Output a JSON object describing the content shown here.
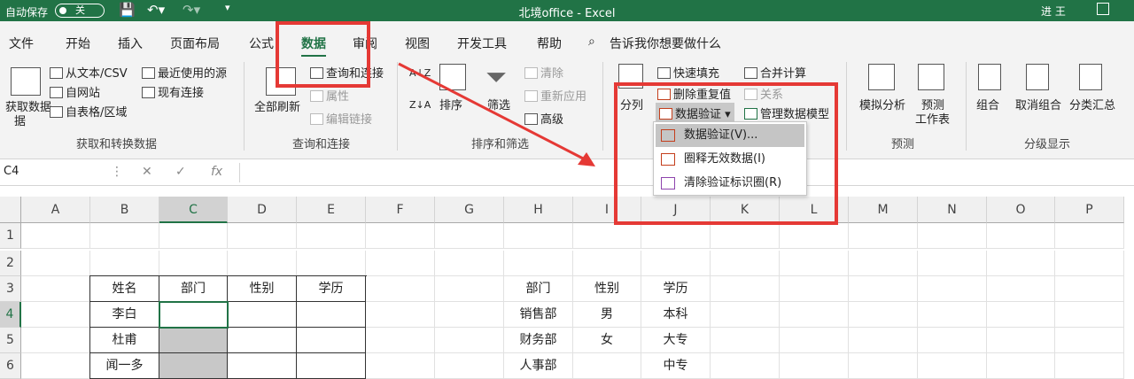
{
  "title_bar": {
    "autosave_label": "自动保存",
    "autosave_state": "关",
    "document_title": "北境office  -  Excel",
    "user_name": "进 王"
  },
  "tabs": [
    {
      "label": "文件"
    },
    {
      "label": "开始"
    },
    {
      "label": "插入"
    },
    {
      "label": "页面布局"
    },
    {
      "label": "公式"
    },
    {
      "label": "数据"
    },
    {
      "label": "审阅"
    },
    {
      "label": "视图"
    },
    {
      "label": "开发工具"
    },
    {
      "label": "帮助"
    }
  ],
  "tell_me": "告诉我你想要做什么",
  "ribbon": {
    "get_data": "获取数据",
    "get_data_2": "据",
    "from_text": "从文本/CSV",
    "from_web": "自网站",
    "from_table": "自表格/区域",
    "recent_sources": "最近使用的源",
    "existing_conn": "现有连接",
    "group_get": "获取和转换数据",
    "refresh_all": "全部刷新",
    "queries": "查询和连接",
    "properties": "属性",
    "edit_links": "编辑链接",
    "group_queries": "查询和连接",
    "sort_az": "A↓Z",
    "sort": "排序",
    "filter": "筛选",
    "clear": "清除",
    "reapply": "重新应用",
    "advanced": "高级",
    "group_sort": "排序和筛选",
    "split": "分列",
    "flash_fill": "快速填充",
    "remove_dup": "删除重复值",
    "data_validation": "数据验证",
    "consolidate": "合并计算",
    "relations": "关系",
    "manage_model": "管理数据模型",
    "what_if": "模拟分析",
    "forecast_1": "预测",
    "forecast_2": "工作表",
    "group_forecast": "预测",
    "group": "组合",
    "ungroup": "取消组合",
    "subtotal": "分类汇总",
    "group_outline": "分级显示"
  },
  "dropdown": {
    "items": [
      {
        "label": "数据验证(V)..."
      },
      {
        "label": "圈释无效数据(I)"
      },
      {
        "label": "清除验证标识圈(R)"
      }
    ]
  },
  "formula_bar": {
    "name_box": "C4",
    "fx": "fx",
    "cancel": "✕",
    "enter": "✓"
  },
  "columns": [
    "A",
    "B",
    "C",
    "D",
    "E",
    "F",
    "G",
    "H",
    "I",
    "J",
    "K",
    "L",
    "M",
    "N",
    "O",
    "P"
  ],
  "rows": [
    "1",
    "2",
    "3",
    "4",
    "5",
    "6"
  ],
  "table1": {
    "headers": [
      "姓名",
      "部门",
      "性别",
      "学历"
    ],
    "names": [
      "李白",
      "杜甫",
      "闻一多"
    ]
  },
  "table2": {
    "headers": [
      "部门",
      "性别",
      "学历"
    ],
    "depts": [
      "销售部",
      "财务部",
      "人事部"
    ],
    "genders": [
      "男",
      "女",
      ""
    ],
    "edu": [
      "本科",
      "大专",
      "中专"
    ]
  },
  "colors": {
    "excel_green": "#217346",
    "highlight_red": "#e53935"
  }
}
